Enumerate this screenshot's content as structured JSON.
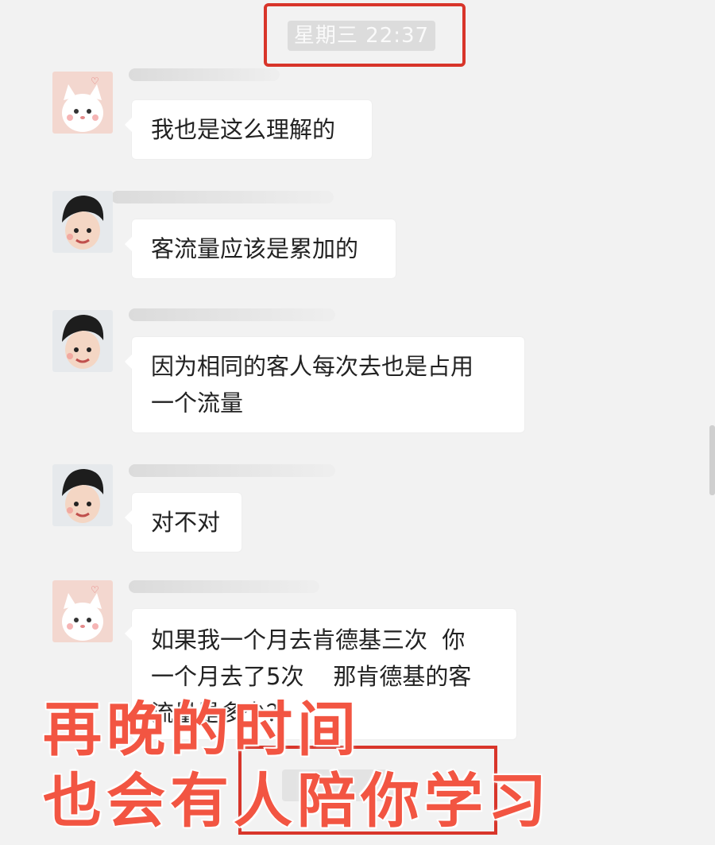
{
  "timestamp": "星期三 22:37",
  "messages": [
    {
      "avatar": "cat-avatar",
      "text": "我也是这么理解的"
    },
    {
      "avatar": "boy-avatar",
      "text": "客流量应该是累加的"
    },
    {
      "avatar": "boy-avatar",
      "line1": "因为相同的客人每次去也是占用",
      "line2": "一个流量"
    },
    {
      "avatar": "boy-avatar",
      "text": "对不对"
    },
    {
      "avatar": "cat-avatar",
      "line1": "如果我一个月去肯德基三次  你",
      "line2": "一个月去了5次    那肯德基的客",
      "line3": "流量是多少？"
    }
  ],
  "caption": {
    "line1": "再晚的时间",
    "line2": "也会有人陪你学习"
  },
  "colors": {
    "accent_red": "#d8352a",
    "caption_fill": "#f25542",
    "chat_bg": "#f2f2f2"
  }
}
